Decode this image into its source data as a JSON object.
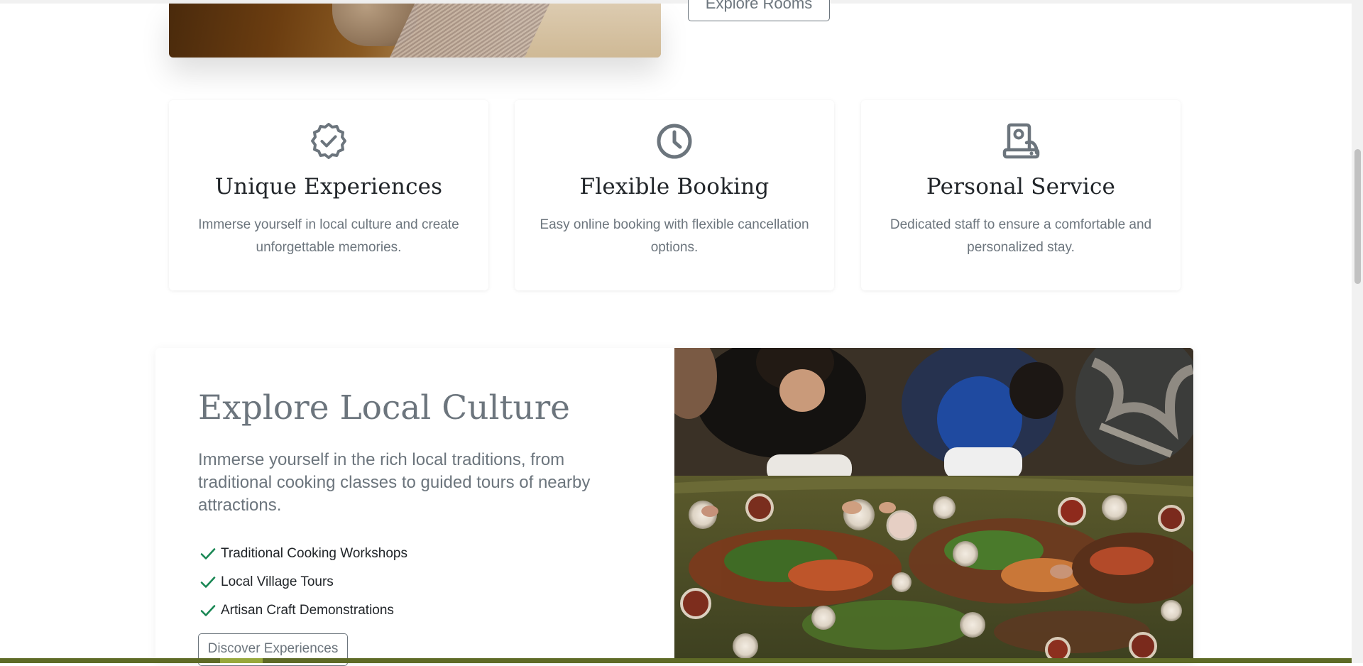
{
  "hero": {
    "explore_rooms_label": "Explore Rooms"
  },
  "features": [
    {
      "icon": "verified-badge-icon",
      "title": "Unique Experiences",
      "description": "Immerse yourself in local culture and create unforgettable memories."
    },
    {
      "icon": "clock-icon",
      "title": "Flexible Booking",
      "description": "Easy online booking with flexible cancellation options."
    },
    {
      "icon": "concierge-service-icon",
      "title": "Personal Service",
      "description": "Dedicated staff to ensure a comfortable and personalized stay."
    }
  ],
  "culture": {
    "title": "Explore Local Culture",
    "lead": "Immerse yourself in the rich local traditions, from traditional cooking classes to guided tours of nearby attractions.",
    "items": [
      "Traditional Cooking Workshops",
      "Local Village Tours",
      "Artisan Craft Demonstrations"
    ],
    "button_label": "Discover Experiences",
    "check_color": "#198754"
  },
  "colors": {
    "muted": "#6c757d",
    "heading": "#212529",
    "footer_bar": "#5e6a26"
  }
}
